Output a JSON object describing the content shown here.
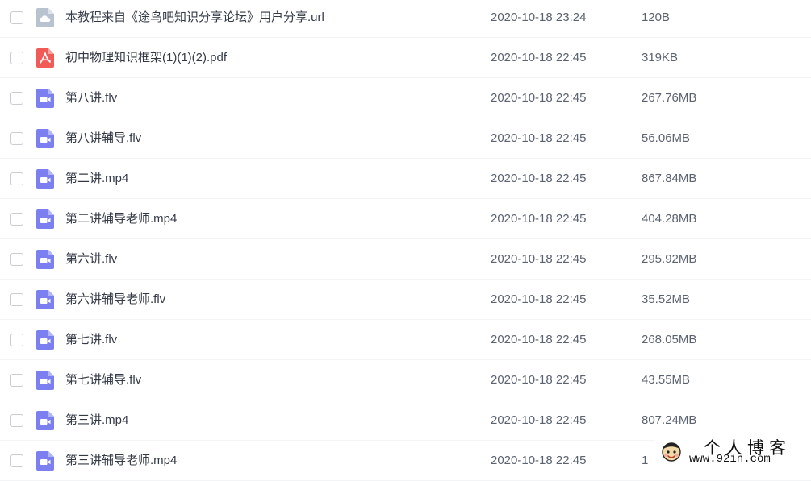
{
  "files": [
    {
      "name": "本教程来自《途鸟吧知识分享论坛》用户分享.url",
      "date": "2020-10-18 23:24",
      "size": "120B",
      "icon": "cloud-file-icon"
    },
    {
      "name": "初中物理知识框架(1)(1)(2).pdf",
      "date": "2020-10-18 22:45",
      "size": "319KB",
      "icon": "pdf-file-icon"
    },
    {
      "name": "第八讲.flv",
      "date": "2020-10-18 22:45",
      "size": "267.76MB",
      "icon": "video-file-icon"
    },
    {
      "name": "第八讲辅导.flv",
      "date": "2020-10-18 22:45",
      "size": "56.06MB",
      "icon": "video-file-icon"
    },
    {
      "name": "第二讲.mp4",
      "date": "2020-10-18 22:45",
      "size": "867.84MB",
      "icon": "video-file-icon"
    },
    {
      "name": "第二讲辅导老师.mp4",
      "date": "2020-10-18 22:45",
      "size": "404.28MB",
      "icon": "video-file-icon"
    },
    {
      "name": "第六讲.flv",
      "date": "2020-10-18 22:45",
      "size": "295.92MB",
      "icon": "video-file-icon"
    },
    {
      "name": "第六讲辅导老师.flv",
      "date": "2020-10-18 22:45",
      "size": "35.52MB",
      "icon": "video-file-icon"
    },
    {
      "name": "第七讲.flv",
      "date": "2020-10-18 22:45",
      "size": "268.05MB",
      "icon": "video-file-icon"
    },
    {
      "name": "第七讲辅导.flv",
      "date": "2020-10-18 22:45",
      "size": "43.55MB",
      "icon": "video-file-icon"
    },
    {
      "name": "第三讲.mp4",
      "date": "2020-10-18 22:45",
      "size": "807.24MB",
      "icon": "video-file-icon"
    },
    {
      "name": "第三讲辅导老师.mp4",
      "date": "2020-10-18 22:45",
      "size": "1",
      "icon": "video-file-icon"
    }
  ],
  "watermark": {
    "title": "个人博客",
    "url": "www.92in.com"
  },
  "colors": {
    "video_icon": "#7b7ff0",
    "pdf_icon": "#f05a57",
    "cloud_icon": "#b9c3cf",
    "text_primary": "#333a46",
    "text_secondary": "#5b6270"
  }
}
